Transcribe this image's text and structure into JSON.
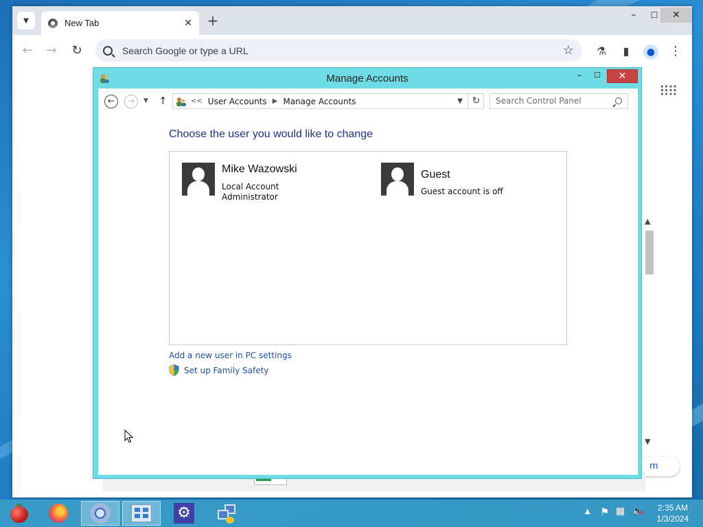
{
  "browser": {
    "tab_title": "New Tab",
    "new_tab_symbol": "+",
    "omnibox_placeholder": "Search Google or type a URL",
    "corner_pill_text": "m"
  },
  "window": {
    "title": "Manage Accounts"
  },
  "addressbar": {
    "breadcrumb_prefix": "<<",
    "breadcrumb": [
      "User Accounts",
      "Manage Accounts"
    ],
    "search_placeholder": "Search Control Panel"
  },
  "content": {
    "heading": "Choose the user you would like to change",
    "accounts": [
      {
        "name": "Mike Wazowski",
        "line1": "Local Account",
        "line2": "Administrator"
      },
      {
        "name": "Guest",
        "line1": "Guest account is off",
        "line2": ""
      }
    ],
    "links": {
      "add_user": "Add a new user in PC settings",
      "family_safety": "Set up Family Safety"
    }
  },
  "taskbar": {
    "apps": [
      "ornament",
      "firefox",
      "chrome",
      "control-panel",
      "settings",
      "network"
    ],
    "active_apps": [
      "chrome",
      "control-panel"
    ],
    "clock_time": "2:35 AM",
    "clock_date": "1/3/2024"
  },
  "colors": {
    "window_frame": "#6fdbe4",
    "heading_text": "#1e3287",
    "link_text": "#1e50a2",
    "close_button": "#c94545",
    "taskbar": "#3ca0c8"
  }
}
